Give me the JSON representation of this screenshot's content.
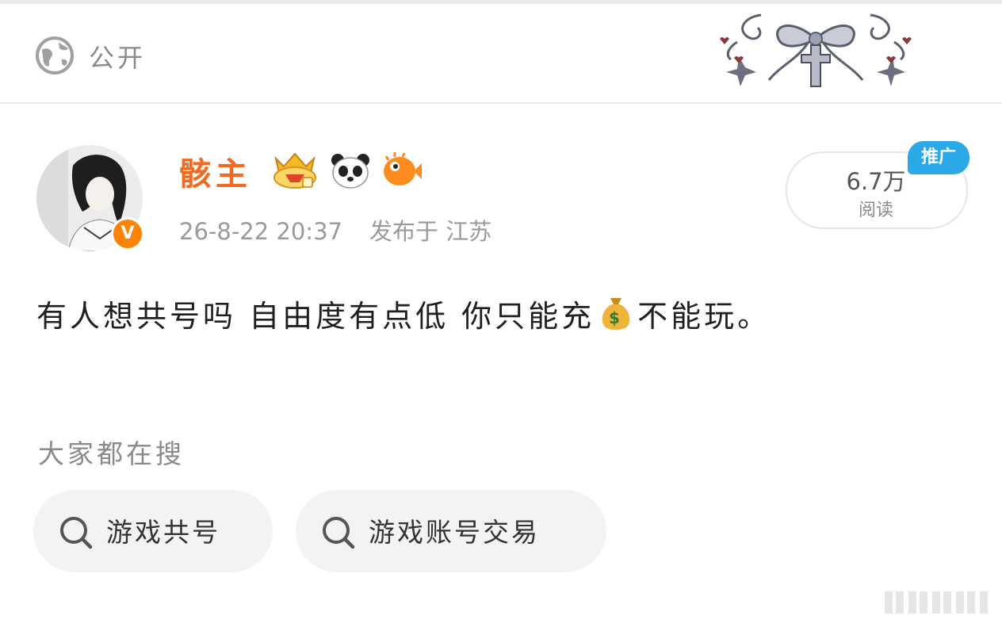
{
  "visibility": {
    "icon": "globe-icon",
    "label": "公开"
  },
  "post": {
    "author": {
      "name": "骸主",
      "verified_badge": "V",
      "badges": [
        "crown-level-badge",
        "panda-badge",
        "pufferfish-badge"
      ]
    },
    "timestamp": "26-8-22 20:37",
    "location": "发布于 江苏",
    "reads": {
      "count": "6.7万",
      "label": "阅读"
    },
    "promo_tag": "推广",
    "content": {
      "before": "有人想共号吗 自由度有点低 你只能充",
      "emoji": "money-bag",
      "after": "不能玩。"
    }
  },
  "searches": {
    "heading": "大家都在搜",
    "items": [
      {
        "label": "游戏共号"
      },
      {
        "label": "游戏账号交易"
      }
    ]
  },
  "colors": {
    "username": "#f26a21",
    "verified": "#ff8200",
    "promo": "#2aa8e8",
    "chip_bg": "#f3f3f3",
    "muted_text": "#8a8a8a"
  }
}
